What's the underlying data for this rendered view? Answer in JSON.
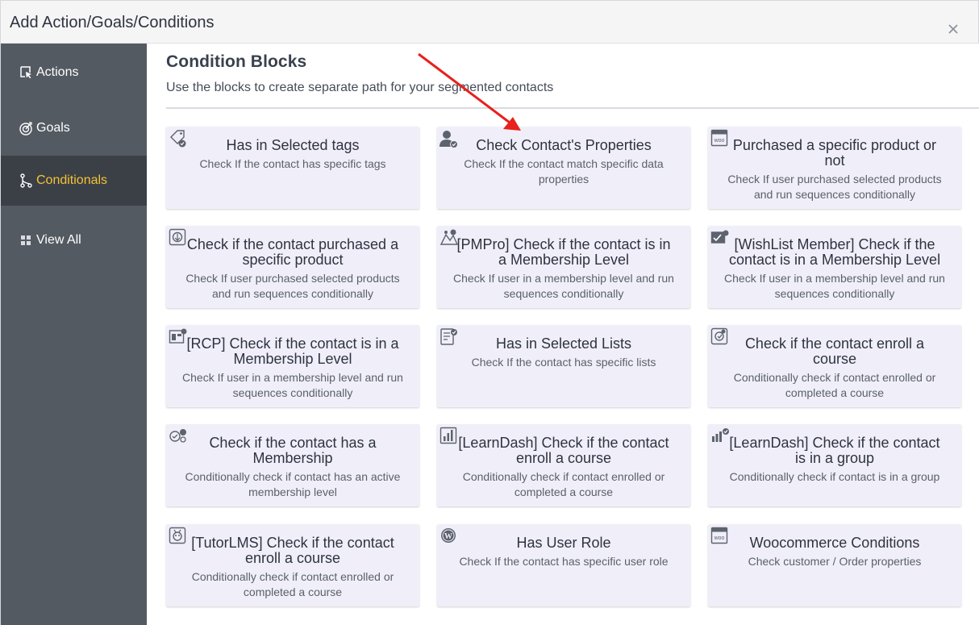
{
  "header": {
    "title": "Add Action/Goals/Conditions"
  },
  "sidebar": {
    "items": [
      {
        "label": "Actions",
        "icon": "pointer-icon"
      },
      {
        "label": "Goals",
        "icon": "target-icon"
      },
      {
        "label": "Conditionals",
        "icon": "branch-icon",
        "active": true
      },
      {
        "label": "View All",
        "icon": "grid-icon"
      }
    ]
  },
  "main": {
    "title": "Condition Blocks",
    "subtitle": "Use the blocks to create separate path for your segmented contacts",
    "cards": [
      {
        "title": "Has in Selected tags",
        "desc": "Check If the contact has specific tags",
        "icon": "tag-icon"
      },
      {
        "title": "Check Contact's Properties",
        "desc": "Check If the contact match specific data properties",
        "icon": "user-icon"
      },
      {
        "title": "Purchased a specific product or not",
        "desc": "Check If user purchased selected products and run sequences conditionally",
        "icon": "woo-icon"
      },
      {
        "title": "Check if the contact purchased a specific product",
        "desc": "Check If user purchased selected products and run sequences conditionally",
        "icon": "edd-icon"
      },
      {
        "title": "[PMPro] Check if the contact is in a Membership Level",
        "desc": "Check If user in a membership level and run sequences conditionally",
        "icon": "pmpro-icon"
      },
      {
        "title": "[WishList Member] Check if the contact is in a Membership Level",
        "desc": "Check If user in a membership level and run sequences conditionally",
        "icon": "wishlist-icon"
      },
      {
        "title": "[RCP] Check if the contact is in a Membership Level",
        "desc": "Check If user in a membership level and run sequences conditionally",
        "icon": "rcp-icon"
      },
      {
        "title": "Has in Selected Lists",
        "desc": "Check If the contact has specific lists",
        "icon": "list-icon"
      },
      {
        "title": "Check if the contact enroll a course",
        "desc": "Conditionally check if contact enrolled or completed a course",
        "icon": "course-icon"
      },
      {
        "title": "Check if the contact has a Membership",
        "desc": "Conditionally check if contact has an active membership level",
        "icon": "membership-icon"
      },
      {
        "title": "[LearnDash] Check if the contact enroll a course",
        "desc": "Conditionally check if contact enrolled or completed a course",
        "icon": "learndash-icon"
      },
      {
        "title": "[LearnDash] Check if the contact is in a group",
        "desc": "Conditionally check if contact is in a group",
        "icon": "group-icon"
      },
      {
        "title": "[TutorLMS] Check if the contact enroll a course",
        "desc": "Conditionally check if contact enrolled or completed a course",
        "icon": "tutorlms-icon"
      },
      {
        "title": "Has User Role",
        "desc": "Check If the contact has specific user role",
        "icon": "wordpress-icon"
      },
      {
        "title": "Woocommerce Conditions",
        "desc": "Check customer / Order properties",
        "icon": "woo-icon"
      }
    ]
  },
  "colors": {
    "sidebar_bg": "#545a62",
    "sidebar_active_bg": "#3b4047",
    "sidebar_active_text": "#f4c234",
    "card_bg": "#f0eff9",
    "annotation_arrow": "#e8211c"
  }
}
